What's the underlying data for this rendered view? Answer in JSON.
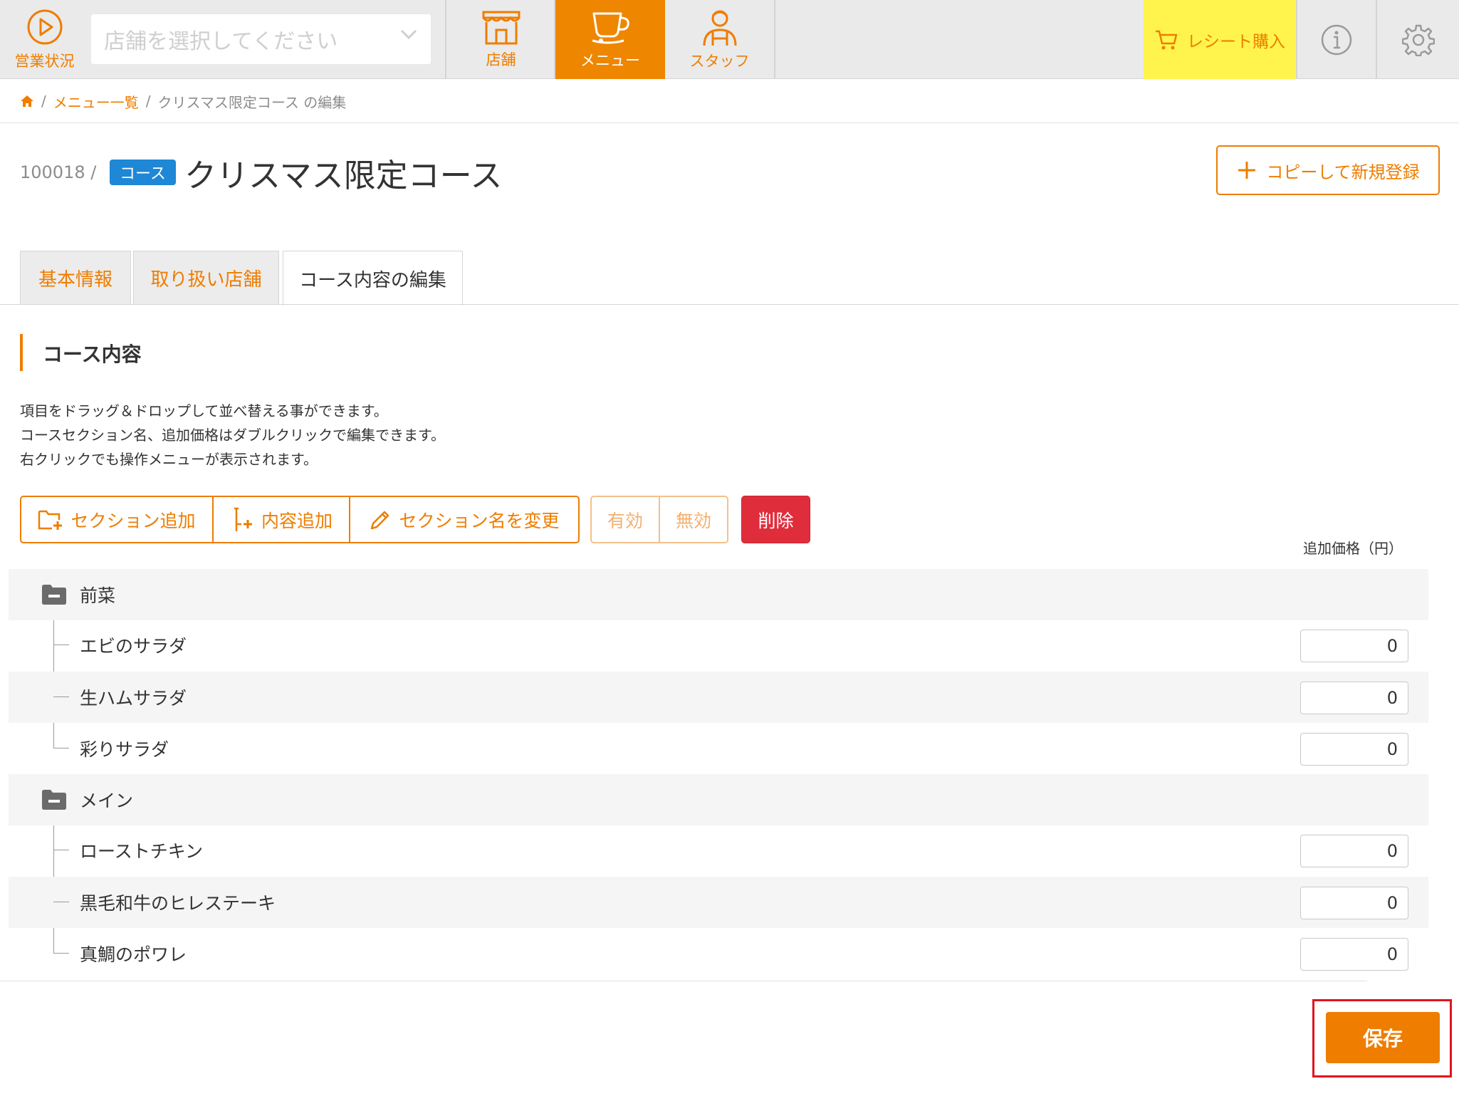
{
  "nav": {
    "status_label": "営業状況",
    "store_select_placeholder": "店舗を選択してください",
    "store_label": "店舗",
    "menu_label": "メニュー",
    "staff_label": "スタッフ",
    "receipt_label": "レシート購入"
  },
  "breadcrumb": {
    "separator": "/",
    "menu_list": "メニュー一覧",
    "current": "クリスマス限定コース の編集"
  },
  "title": {
    "id": "100018 /",
    "badge": "コース",
    "name": "クリスマス限定コース",
    "copy_button": "コピーして新規登録"
  },
  "tabs": {
    "basic": "基本情報",
    "stores": "取り扱い店舗",
    "course": "コース内容の編集"
  },
  "section": {
    "title": "コース内容",
    "help": [
      "項目をドラッグ＆ドロップして並べ替える事ができます。",
      "コースセクション名、追加価格はダブルクリックで編集できます。",
      "右クリックでも操作メニューが表示されます。"
    ]
  },
  "actions": {
    "add_section": "セクション追加",
    "add_content": "内容追加",
    "rename_section": "セクション名を変更",
    "enable": "有効",
    "disable": "無効",
    "delete": "削除"
  },
  "price_header": "追加価格（円）",
  "tree": [
    {
      "section": "前菜",
      "items": [
        {
          "name": "エビのサラダ",
          "price": "0"
        },
        {
          "name": "生ハムサラダ",
          "price": "0"
        },
        {
          "name": "彩りサラダ",
          "price": "0"
        }
      ]
    },
    {
      "section": "メイン",
      "items": [
        {
          "name": "ローストチキン",
          "price": "0"
        },
        {
          "name": "黒毛和牛のヒレステーキ",
          "price": "0"
        },
        {
          "name": "真鯛のポワレ",
          "price": "0"
        }
      ]
    }
  ],
  "save_button": "保存",
  "colors": {
    "accent": "#ee7d00",
    "receipt_bg": "#fff44d",
    "badge": "#1e87d6",
    "danger": "#e02d3c",
    "highlight": "#e0141e"
  },
  "icons": [
    "play-circle-icon",
    "chevron-down-icon",
    "storefront-icon",
    "coffee-cup-icon",
    "staff-person-icon",
    "cart-icon",
    "info-circle-icon",
    "gear-icon",
    "home-icon",
    "plus-icon",
    "folder-plus-icon",
    "tree-plus-icon",
    "pencil-icon",
    "folder-minus-icon"
  ]
}
